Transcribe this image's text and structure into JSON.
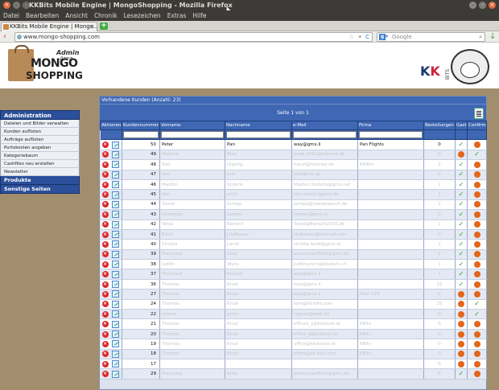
{
  "window": {
    "title": "KKBits Mobile Engine | MongoShopping - Mozilla Firefox",
    "close_glyph": "×",
    "min_glyph": "–",
    "max_glyph": "□"
  },
  "menu": [
    "Datei",
    "Bearbeiten",
    "Ansicht",
    "Chronik",
    "Lesezeichen",
    "Extras",
    "Hilfe"
  ],
  "tab": {
    "label": "KKBits Mobile Engine | Mongo...",
    "close_glyph": "×",
    "new_glyph": "+"
  },
  "navbar": {
    "back_glyph": "‹",
    "url": "www.mongo-shopping.com",
    "star_glyph": "☆",
    "dropdown_glyph": "▾",
    "reload_glyph": "C",
    "search_placeholder": "Google",
    "search_engine_glyph": "g",
    "search_dd_glyph": "▾",
    "search_glyph": "⌕",
    "download_glyph": "↓"
  },
  "logo": {
    "admin": "Admin",
    "area": "Area",
    "mongo": "MONGO",
    "shopping": "SHOPPING"
  },
  "kklogo": {
    "k1": "K",
    "k2": "K",
    "bits": "BITS"
  },
  "sidebar": {
    "section_title": "Administration",
    "items": [
      "Dateien und Bilder verwalten",
      "Kunden auflisten",
      "Aufträge auflisten",
      "Portokosten angeben",
      "Kategoriebaum",
      "Cashfiles neu erstellen",
      "Newsletter"
    ],
    "products": "Produkte",
    "other": "Sonstige Seiten"
  },
  "main": {
    "caption": "Vorhandene Kunden (Anzahl: 23)",
    "pager": "Seite 1 von 1",
    "columns": [
      "Aktionen",
      "Kundennummer",
      "Vorname",
      "Nachname",
      "e-Mail",
      "Firma",
      "Bestellungen",
      "Gast",
      "Confirm"
    ],
    "rows": [
      {
        "id": "50",
        "vorname": "Peter",
        "nachname": "Pan",
        "email": "way@gmx.li",
        "firma": "Pan Flights",
        "best": "0",
        "gast": "y",
        "confirm": "n"
      },
      {
        "id": "49",
        "vorname": "Melanie",
        "nachname": "Bürs",
        "email": "mela_bi91@hotmail.de",
        "firma": "",
        "best": "0",
        "gast": "n",
        "confirm": "y"
      },
      {
        "id": "48",
        "vorname": "Tost",
        "nachname": "Ulgolfg",
        "email": "hansf@hotmail.de",
        "firma": "KKBits",
        "best": "2",
        "gast": "y",
        "confirm": "n"
      },
      {
        "id": "47",
        "vorname": "test",
        "nachname": "test",
        "email": "test@me.de",
        "firma": "",
        "best": "0",
        "gast": "y",
        "confirm": "n"
      },
      {
        "id": "46",
        "vorname": "Madlon",
        "nachname": "Scdvrix",
        "email": "Madlon.Scdvrix@gmx.net",
        "firma": "",
        "best": "1",
        "gast": "y",
        "confirm": "n"
      },
      {
        "id": "45",
        "vorname": "kim",
        "nachname": "sichr",
        "email": "kim.stuehr@gmx.de",
        "firma": "",
        "best": "1",
        "gast": "y",
        "confirm": "n"
      },
      {
        "id": "44",
        "vorname": "David",
        "nachname": "Schipp",
        "email": "schipp@maulwesuch.de",
        "firma": "",
        "best": "1",
        "gast": "y",
        "confirm": "n"
      },
      {
        "id": "43",
        "vorname": "Christoph",
        "nachname": "Lehner",
        "email": "lehner@gmx.ch",
        "firma": "",
        "best": "0",
        "gast": "y",
        "confirm": "n"
      },
      {
        "id": "42",
        "vorname": "Tanja",
        "nachname": "Bartsch",
        "email": "Tanja@Bartsch2015.de",
        "firma": "",
        "best": "1",
        "gast": "y",
        "confirm": "n"
      },
      {
        "id": "41",
        "vorname": "Erich",
        "nachname": "Lilalbauer",
        "email": "lilclpower@hotmail.com",
        "firma": "",
        "best": "0",
        "gast": "y",
        "confirm": "n"
      },
      {
        "id": "40",
        "vorname": "Christa",
        "nachname": "Landl",
        "email": "christa.landl@gmx.at",
        "firma": "",
        "best": "1",
        "gast": "y",
        "confirm": "n"
      },
      {
        "id": "39",
        "vorname": "Franziska",
        "nachname": "Grau",
        "email": "anemonenfisch@gmx.de",
        "firma": "",
        "best": "2",
        "gast": "y",
        "confirm": "n"
      },
      {
        "id": "38",
        "vorname": "Judith",
        "nachname": "Wyss",
        "email": "judithursch@bluewin.ch",
        "firma": "",
        "best": "1",
        "gast": "y",
        "confirm": "n"
      },
      {
        "id": "37",
        "vorname": "Thomasd",
        "nachname": "Krousd",
        "email": "way@gmx.li",
        "firma": "",
        "best": "1",
        "gast": "y",
        "confirm": "n"
      },
      {
        "id": "36",
        "vorname": "Thomas",
        "nachname": "Krcal",
        "email": "way@gmx.li",
        "firma": "",
        "best": "15",
        "gast": "y",
        "confirm": "n"
      },
      {
        "id": "27",
        "vorname": "Thomas",
        "nachname": "Krcal",
        "email": "way@gmx.li",
        "firma": "Haxi 123",
        "best": "0",
        "gast": "n",
        "confirm": "n"
      },
      {
        "id": "24",
        "vorname": "Thomas",
        "nachname": "Krcal",
        "email": "tom@kk-bits.com",
        "firma": "",
        "best": "25",
        "gast": "n",
        "confirm": "y"
      },
      {
        "id": "22",
        "vorname": "roland",
        "nachname": "grosc",
        "email": "ragnos@web.de",
        "firma": "",
        "best": "0",
        "gast": "n",
        "confirm": "y"
      },
      {
        "id": "21",
        "vorname": "Thomas",
        "nachname": "Krcal",
        "email": "office1_s@kokover.at",
        "firma": "KBits",
        "best": "0",
        "gast": "n",
        "confirm": "n"
      },
      {
        "id": "20",
        "vorname": "Thomas",
        "nachname": "Krcal",
        "email": "office_s@kokover.at",
        "firma": "KBits",
        "best": "0",
        "gast": "n",
        "confirm": "n"
      },
      {
        "id": "19",
        "vorname": "Thomas",
        "nachname": "Krcal",
        "email": "office@kkokover.at",
        "firma": "KBits",
        "best": "0",
        "gast": "n",
        "confirm": "n"
      },
      {
        "id": "18",
        "vorname": "Thomas",
        "nachname": "Krcal",
        "email": "office@kk-bits.com",
        "firma": "KBits",
        "best": "0",
        "gast": "n",
        "confirm": "n"
      },
      {
        "id": "17",
        "vorname": "",
        "nachname": "",
        "email": "",
        "firma": "",
        "best": "0",
        "gast": "n",
        "confirm": "n"
      },
      {
        "id": "29",
        "vorname": "Franziska",
        "nachname": "Grau",
        "email": "anemonenfisch@gmx.de",
        "firma": "",
        "best": "0",
        "gast": "y",
        "confirm": "n"
      }
    ]
  },
  "icons": {
    "delete": "×",
    "yes": "✓",
    "no": "⊘"
  },
  "colors": {
    "header_blue": "#3f67b3",
    "frame_brown": "#a28e6c",
    "delete_red": "#d9262b",
    "ok_green": "#2c9a2c",
    "no_orange": "#e2661b"
  }
}
